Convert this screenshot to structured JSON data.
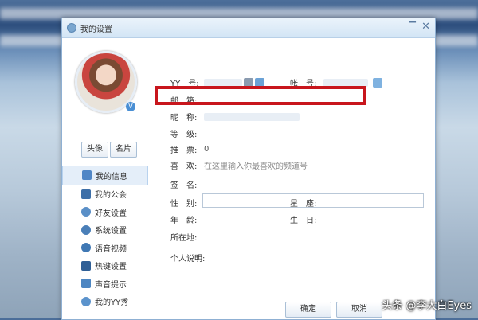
{
  "window": {
    "title": "我的设置"
  },
  "profile": {
    "avatar_buttons": [
      "头像",
      "名片"
    ],
    "verified_badge": "V"
  },
  "menu": [
    {
      "label": "我的信息",
      "icon": "profile-card-icon"
    },
    {
      "label": "我的公会",
      "icon": "flag-icon"
    },
    {
      "label": "好友设置",
      "icon": "friend-icon"
    },
    {
      "label": "系统设置",
      "icon": "gear-icon"
    },
    {
      "label": "语音视频",
      "icon": "speaker-icon"
    },
    {
      "label": "热键设置",
      "icon": "keyboard-icon"
    },
    {
      "label": "声音提示",
      "icon": "music-note-icon"
    },
    {
      "label": "我的YY秀",
      "icon": "avatar-show-icon"
    }
  ],
  "info": {
    "yy_label": "YY　号:",
    "account_label": "帐　号:",
    "email_label": "邮　箱:",
    "nickname_label": "昵　称:",
    "level_label": "等　级:",
    "recommend_label": "推　票:",
    "recommend_value": "0",
    "likes_label": "喜　欢:",
    "likes_hint": "在这里输入你最喜欢的频道号",
    "signature_label": "签　名:",
    "gender_label": "性　别:",
    "zodiac_label": "星　座:",
    "age_label": "年　龄:",
    "birthday_label": "生　日:",
    "location_label": "所在地:",
    "bio_label": "个人说明:"
  },
  "footer": {
    "ok_label": "确定",
    "cancel_label": "取消"
  },
  "watermark": "头条 @李大白Eyes",
  "colors": {
    "highlight": "#c8161d",
    "accent": "#4a8fd4"
  }
}
